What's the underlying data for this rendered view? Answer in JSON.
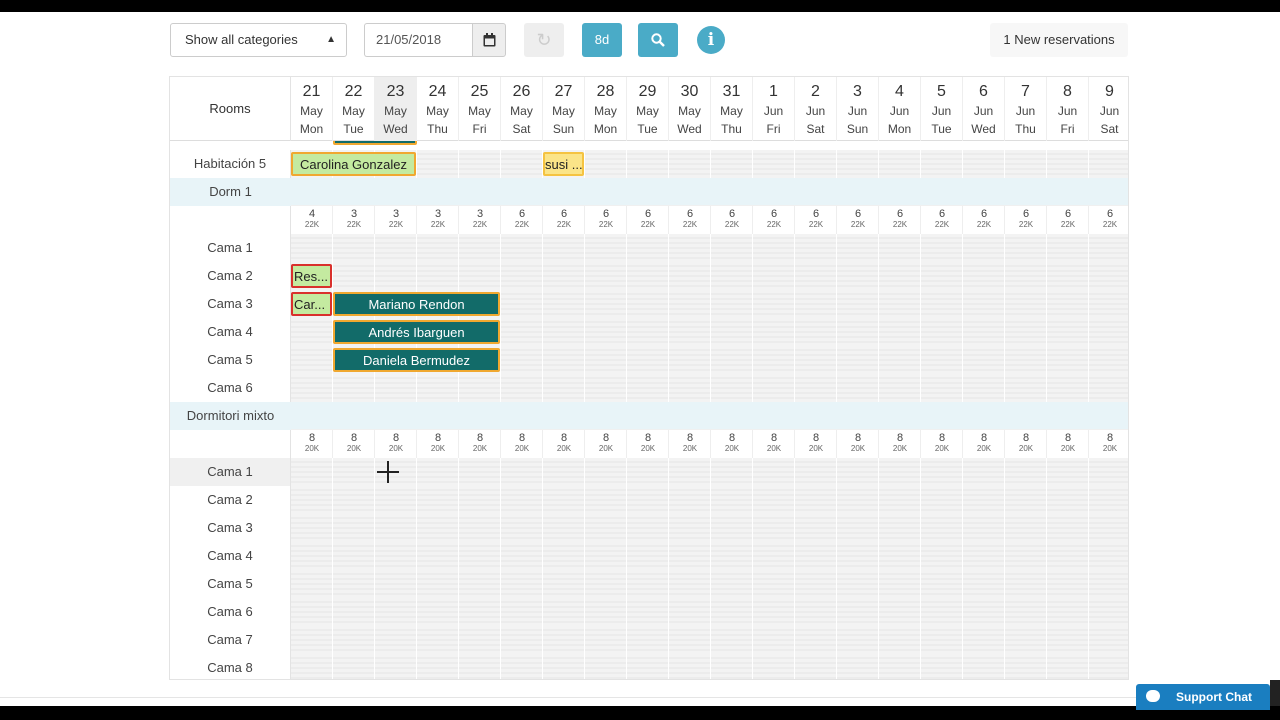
{
  "toolbar": {
    "category_select": "Show all categories",
    "date": "21/05/2018",
    "btn_8d": "8d",
    "new_reservations": "1 New reservations"
  },
  "grid": {
    "rooms_header": "Rooms",
    "days": [
      {
        "num": "21",
        "month": "May",
        "weekday": "Mon"
      },
      {
        "num": "22",
        "month": "May",
        "weekday": "Tue"
      },
      {
        "num": "23",
        "month": "May",
        "weekday": "Wed",
        "today": true
      },
      {
        "num": "24",
        "month": "May",
        "weekday": "Thu"
      },
      {
        "num": "25",
        "month": "May",
        "weekday": "Fri"
      },
      {
        "num": "26",
        "month": "May",
        "weekday": "Sat"
      },
      {
        "num": "27",
        "month": "May",
        "weekday": "Sun"
      },
      {
        "num": "28",
        "month": "May",
        "weekday": "Mon"
      },
      {
        "num": "29",
        "month": "May",
        "weekday": "Tue"
      },
      {
        "num": "30",
        "month": "May",
        "weekday": "Wed"
      },
      {
        "num": "31",
        "month": "May",
        "weekday": "Thu"
      },
      {
        "num": "1",
        "month": "Jun",
        "weekday": "Fri"
      },
      {
        "num": "2",
        "month": "Jun",
        "weekday": "Sat"
      },
      {
        "num": "3",
        "month": "Jun",
        "weekday": "Sun"
      },
      {
        "num": "4",
        "month": "Jun",
        "weekday": "Mon"
      },
      {
        "num": "5",
        "month": "Jun",
        "weekday": "Tue"
      },
      {
        "num": "6",
        "month": "Jun",
        "weekday": "Wed"
      },
      {
        "num": "7",
        "month": "Jun",
        "weekday": "Thu"
      },
      {
        "num": "8",
        "month": "Jun",
        "weekday": "Fri"
      },
      {
        "num": "9",
        "month": "Jun",
        "weekday": "Sat"
      }
    ],
    "rows": [
      {
        "type": "room",
        "label": "Habitación 5",
        "hover": false
      },
      {
        "type": "category",
        "label": "Dorm 1"
      },
      {
        "type": "avail",
        "counts": [
          "4",
          "3",
          "3",
          "3",
          "3",
          "6",
          "6",
          "6",
          "6",
          "6",
          "6",
          "6",
          "6",
          "6",
          "6",
          "6",
          "6",
          "6",
          "6",
          "6"
        ],
        "price": "22K"
      },
      {
        "type": "room",
        "label": "Cama 1",
        "hover": false
      },
      {
        "type": "room",
        "label": "Cama 2",
        "hover": false
      },
      {
        "type": "room",
        "label": "Cama 3",
        "hover": false
      },
      {
        "type": "room",
        "label": "Cama 4",
        "hover": false
      },
      {
        "type": "room",
        "label": "Cama 5",
        "hover": false
      },
      {
        "type": "room",
        "label": "Cama 6",
        "hover": false
      },
      {
        "type": "category",
        "label": "Dormitori mixto"
      },
      {
        "type": "avail",
        "counts": [
          "8",
          "8",
          "8",
          "8",
          "8",
          "8",
          "8",
          "8",
          "8",
          "8",
          "8",
          "8",
          "8",
          "8",
          "8",
          "8",
          "8",
          "8",
          "8",
          "8"
        ],
        "price": "20K"
      },
      {
        "type": "room",
        "label": "Cama 1",
        "hover": true
      },
      {
        "type": "room",
        "label": "Cama 2",
        "hover": false
      },
      {
        "type": "room",
        "label": "Cama 3",
        "hover": false
      },
      {
        "type": "room",
        "label": "Cama 4",
        "hover": false
      },
      {
        "type": "room",
        "label": "Cama 5",
        "hover": false
      },
      {
        "type": "room",
        "label": "Cama 6",
        "hover": false
      },
      {
        "type": "room",
        "label": "Cama 7",
        "hover": false
      },
      {
        "type": "room",
        "label": "Cama 8",
        "hover": false
      }
    ],
    "reservations": [
      {
        "row": 0,
        "start": 0,
        "days": 3,
        "label": "Carolina Gonzalez",
        "style": "green"
      },
      {
        "row": 0,
        "start": 6,
        "days": 1,
        "label": "susi ...",
        "style": "yellow"
      },
      {
        "row": 4,
        "start": 0,
        "days": 1,
        "label": "Res...",
        "style": "green-red"
      },
      {
        "row": 5,
        "start": 0,
        "days": 1,
        "label": "Car...",
        "style": "green-red"
      },
      {
        "row": 5,
        "start": 1,
        "days": 4,
        "label": "Mariano Rendon",
        "style": "teal"
      },
      {
        "row": 6,
        "start": 1,
        "days": 4,
        "label": "Andrés Ibarguen",
        "style": "teal"
      },
      {
        "row": 7,
        "start": 1,
        "days": 4,
        "label": "Daniela Bermudez",
        "style": "teal"
      }
    ]
  },
  "support_chat": "Support Chat"
}
